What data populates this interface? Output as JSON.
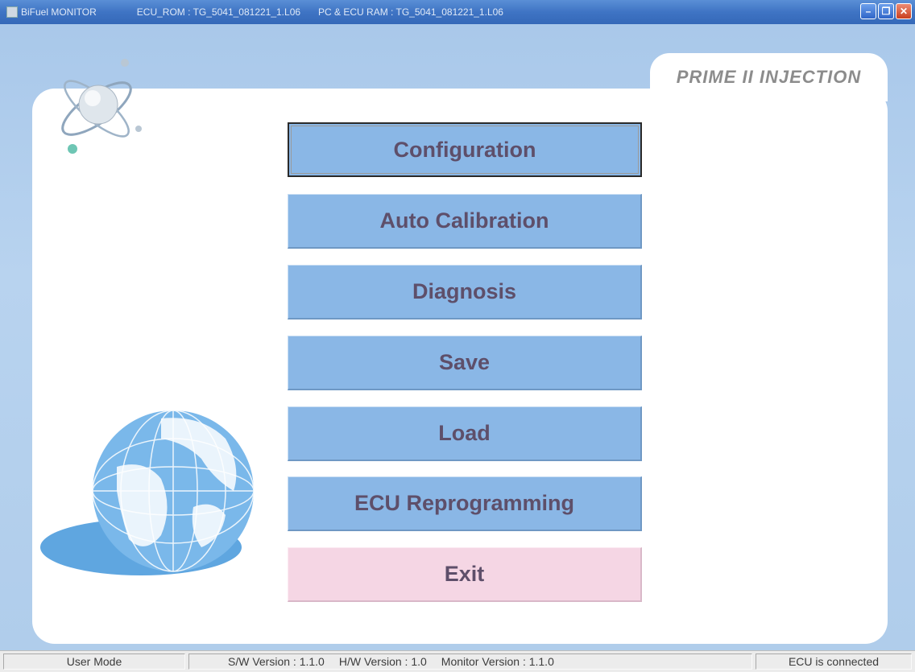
{
  "titlebar": {
    "app_name": "BiFuel MONITOR",
    "ecu_rom": "ECU_ROM :  TG_5041_081221_1.L06",
    "pc_ecu_ram": "PC & ECU RAM :  TG_5041_081221_1.L06"
  },
  "brand": {
    "label": "PRIME II  INJECTION"
  },
  "menu": {
    "items": [
      {
        "label": "Configuration"
      },
      {
        "label": "Auto Calibration"
      },
      {
        "label": "Diagnosis"
      },
      {
        "label": "Save"
      },
      {
        "label": "Load"
      },
      {
        "label": "ECU Reprogramming"
      },
      {
        "label": "Exit"
      }
    ]
  },
  "statusbar": {
    "mode": "User Mode",
    "sw_version": "S/W Version :  1.1.0",
    "hw_version": "H/W Version :  1.0",
    "monitor_version": "Monitor Version : 1.1.0",
    "connection": "ECU is connected"
  },
  "colors": {
    "button_blue": "#8ab7e6",
    "exit_pink": "#f5d6e4",
    "background_blue": "#b0cdeb",
    "button_text": "#5e4f6a"
  },
  "icons": [
    "app-icon",
    "minimize-icon",
    "maximize-icon",
    "close-icon",
    "atom-logo-icon",
    "globe-icon"
  ]
}
